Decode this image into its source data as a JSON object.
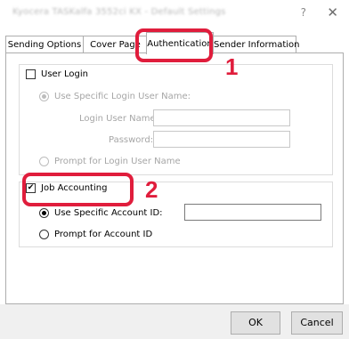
{
  "window": {
    "title": "Kyocera TASKalfa 3552ci KX - Default Settings",
    "help_glyph": "?",
    "close_glyph": "✕"
  },
  "tabs": [
    {
      "label": "Sending Options"
    },
    {
      "label": "Cover Page"
    },
    {
      "label": "Authentication",
      "active": true
    },
    {
      "label": "Sender Information"
    }
  ],
  "user_login": {
    "label": "User Login",
    "checked": false,
    "use_specific_label": "Use Specific Login User Name:",
    "login_user_name_label": "Login User Name:",
    "login_user_name_value": "",
    "password_label": "Password:",
    "password_value": "",
    "prompt_label": "Prompt for Login User Name"
  },
  "job_accounting": {
    "label": "Job Accounting",
    "checked": true,
    "use_specific_label": "Use Specific Account ID:",
    "account_id_value": "",
    "prompt_label": "Prompt for Account ID"
  },
  "buttons": {
    "ok": "OK",
    "cancel": "Cancel"
  },
  "callouts": {
    "one": "1",
    "two": "2",
    "color": "#e01d3c"
  }
}
